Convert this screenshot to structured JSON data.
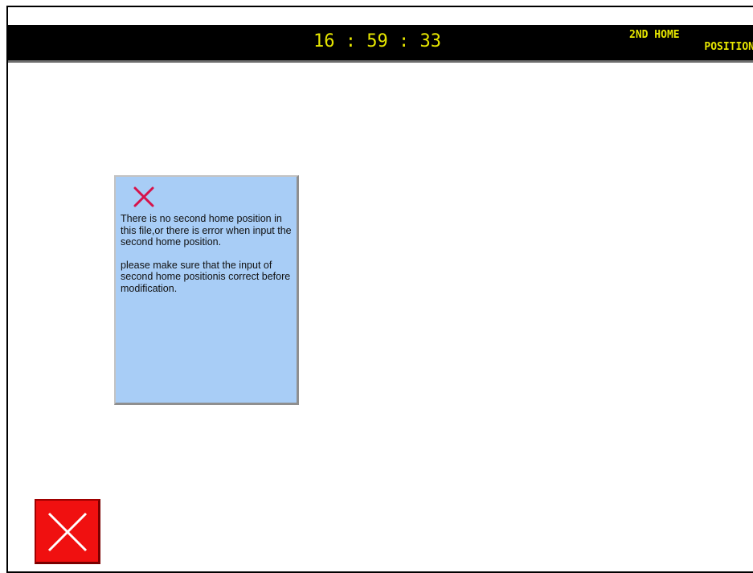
{
  "header": {
    "clock": "16 : 59 : 33",
    "mode_line_1": "2ND HOME",
    "mode_line_2": "POSITION"
  },
  "message_box": {
    "icon": "error-x-icon",
    "paragraph_1": "There is no second home position in this file,or there is error when input the second home position.",
    "paragraph_2": "please make sure that the input of second home positionis correct before modification."
  },
  "footer": {
    "close_button_icon": "close-icon"
  },
  "colors": {
    "title_bar_bg": "#000000",
    "title_text": "#e6e600",
    "message_bg": "#a8cdf6",
    "error_icon": "#d6124a",
    "close_button_bg": "#f01010"
  }
}
